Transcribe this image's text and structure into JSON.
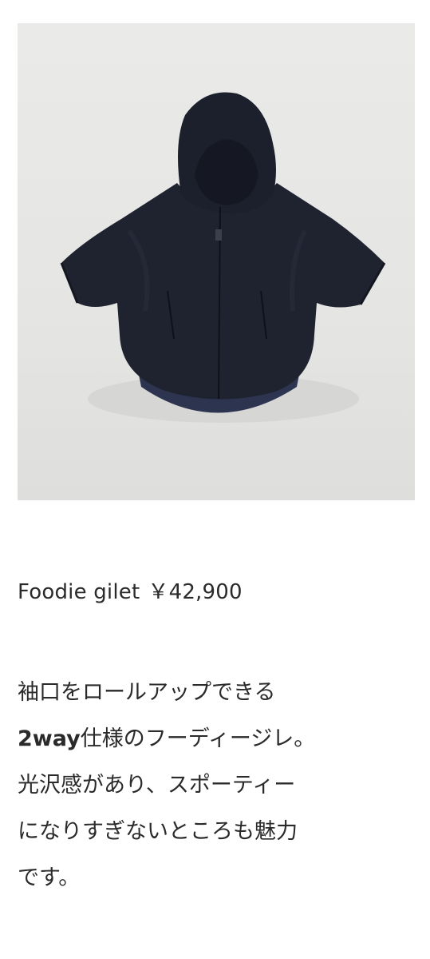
{
  "product": {
    "name": "Foodie gilet",
    "price": "￥42,900"
  },
  "description": {
    "line1": "袖口をロールアップできる",
    "line2_bold": "2way",
    "line2_rest": "仕様のフーディージレ。",
    "line3": "光沢感があり、スポーティー",
    "line4": "になりすぎないところも魅力",
    "line5": "です。"
  },
  "colors": {
    "background": "#ffffff",
    "photo_background": "#e6e6e4",
    "garment": "#1f2330",
    "text": "#2a2a2a"
  }
}
